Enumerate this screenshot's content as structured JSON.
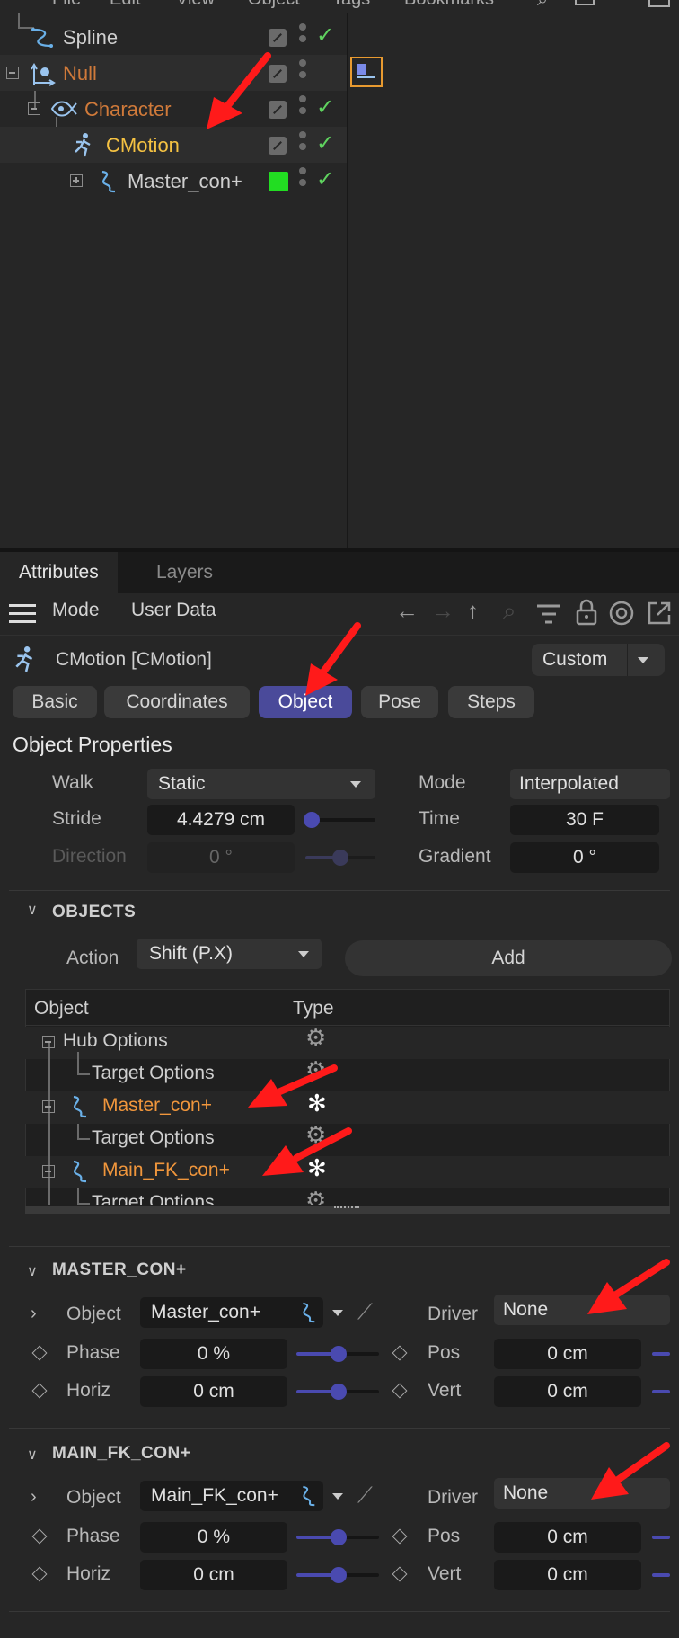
{
  "menu": [
    "File",
    "Edit",
    "View",
    "Object",
    "Tags",
    "Bookmarks"
  ],
  "objects": [
    {
      "name": "Spline"
    },
    {
      "name": "Null"
    },
    {
      "name": "Character"
    },
    {
      "name": "CMotion"
    },
    {
      "name": "Master_con+"
    }
  ],
  "tabs": {
    "attributes": "Attributes",
    "layers": "Layers"
  },
  "toolbar": {
    "mode": "Mode",
    "user_data": "User Data"
  },
  "header": {
    "title": "CMotion [CMotion]",
    "preset": "Custom"
  },
  "subtabs": [
    "Basic",
    "Coordinates",
    "Object",
    "Pose",
    "Steps"
  ],
  "object_properties": {
    "title": "Object Properties",
    "walk_label": "Walk",
    "walk_value": "Static",
    "mode_label": "Mode",
    "mode_value": "Interpolated",
    "stride_label": "Stride",
    "stride_value": "4.4279 cm",
    "time_label": "Time",
    "time_value": "30 F",
    "direction_label": "Direction",
    "direction_value": "0 °",
    "gradient_label": "Gradient",
    "gradient_value": "0 °"
  },
  "objects_section": {
    "title": "OBJECTS",
    "action_label": "Action",
    "action_value": "Shift (P.X)",
    "add_label": "Add",
    "col_object": "Object",
    "col_type": "Type",
    "rows": [
      {
        "name": "Hub Options"
      },
      {
        "name": "Target Options"
      },
      {
        "name": "Master_con+"
      },
      {
        "name": "Target Options"
      },
      {
        "name": "Main_FK_con+"
      },
      {
        "name": "Target Options"
      }
    ]
  },
  "sections": [
    {
      "title": "MASTER_CON+",
      "object_label": "Object",
      "object_value": "Master_con+",
      "driver_label": "Driver",
      "driver_value": "None",
      "phase_label": "Phase",
      "phase_value": "0 %",
      "pos_label": "Pos",
      "pos_value": "0 cm",
      "horiz_label": "Horiz",
      "horiz_value": "0 cm",
      "vert_label": "Vert",
      "vert_value": "0 cm"
    },
    {
      "title": "MAIN_FK_CON+",
      "object_label": "Object",
      "object_value": "Main_FK_con+",
      "driver_label": "Driver",
      "driver_value": "None",
      "phase_label": "Phase",
      "phase_value": "0 %",
      "pos_label": "Pos",
      "pos_value": "0 cm",
      "horiz_label": "Horiz",
      "horiz_value": "0 cm",
      "vert_label": "Vert",
      "vert_value": "0 cm"
    }
  ],
  "colors": {
    "accent": "#4a4a9a",
    "null_label": "#d07a3a",
    "cmotion_label": "#f5c242",
    "target_name": "#f0963c",
    "check": "#5fd35f",
    "layer_green": "#22dd22",
    "annotation_arrow": "#ff1a1a"
  }
}
